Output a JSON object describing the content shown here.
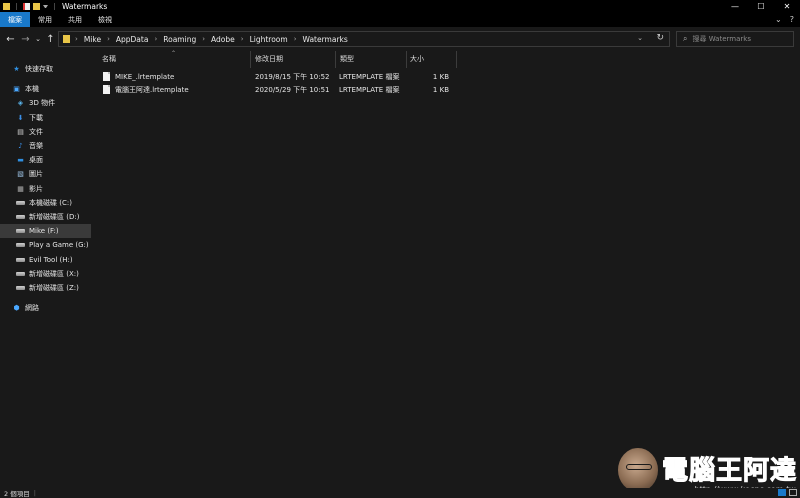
{
  "window": {
    "title": "Watermarks",
    "controls": {
      "minimize": "—",
      "maximize": "☐",
      "close": "✕"
    }
  },
  "ribbon": {
    "tabs": [
      {
        "label": "檔案",
        "active": true
      },
      {
        "label": "常用",
        "active": false
      },
      {
        "label": "共用",
        "active": false
      },
      {
        "label": "檢視",
        "active": false
      }
    ],
    "expand_icon": "⌄",
    "help_icon": "?"
  },
  "address": {
    "crumbs": [
      "Mike",
      "AppData",
      "Roaming",
      "Adobe",
      "Lightroom",
      "Watermarks"
    ],
    "search_placeholder": "搜尋 Watermarks"
  },
  "nav": {
    "items": [
      {
        "label": "快速存取",
        "icon": "star-icon",
        "indent": 12,
        "selected": false
      },
      {
        "label": "本機",
        "icon": "computer-icon",
        "indent": 12,
        "selected": false
      },
      {
        "label": "3D 物件",
        "icon": "cube-icon",
        "indent": 16,
        "selected": false
      },
      {
        "label": "下載",
        "icon": "download-icon",
        "indent": 16,
        "selected": false
      },
      {
        "label": "文件",
        "icon": "document-icon",
        "indent": 16,
        "selected": false
      },
      {
        "label": "音樂",
        "icon": "music-icon",
        "indent": 16,
        "selected": false
      },
      {
        "label": "桌面",
        "icon": "desktop-icon",
        "indent": 16,
        "selected": false
      },
      {
        "label": "圖片",
        "icon": "pictures-icon",
        "indent": 16,
        "selected": false
      },
      {
        "label": "影片",
        "icon": "video-icon",
        "indent": 16,
        "selected": false
      },
      {
        "label": "本機磁碟 (C:)",
        "icon": "drive-icon",
        "indent": 16,
        "selected": false
      },
      {
        "label": "新增磁碟區 (D:)",
        "icon": "drive-icon",
        "indent": 16,
        "selected": false
      },
      {
        "label": "Mike (F:)",
        "icon": "drive-icon",
        "indent": 16,
        "selected": true
      },
      {
        "label": "Play a Game (G:)",
        "icon": "drive-icon",
        "indent": 16,
        "selected": false
      },
      {
        "label": "Evil Tool (H:)",
        "icon": "drive-icon",
        "indent": 16,
        "selected": false
      },
      {
        "label": "新增磁碟區 (X:)",
        "icon": "drive-icon",
        "indent": 16,
        "selected": false
      },
      {
        "label": "新增磁碟區 (Z:)",
        "icon": "drive-icon",
        "indent": 16,
        "selected": false
      },
      {
        "label": "網路",
        "icon": "network-icon",
        "indent": 12,
        "selected": false
      }
    ]
  },
  "columns": {
    "name": "名稱",
    "modified": "修改日期",
    "type": "類型",
    "size": "大小"
  },
  "files": [
    {
      "name": "MIKE_.lrtemplate",
      "modified": "2019/8/15 下午 10:52",
      "type": "LRTEMPLATE 檔案",
      "size": "1 KB"
    },
    {
      "name": "電腦王阿達.lrtemplate",
      "modified": "2020/5/29 下午 10:51",
      "type": "LRTEMPLATE 檔案",
      "size": "1 KB"
    }
  ],
  "status": {
    "count": "2 個項目"
  },
  "watermark": {
    "text": "電腦王阿達",
    "url": "http://www.kocpc.com.tw"
  },
  "colors": {
    "accent": "#1979ca",
    "background": "#191919",
    "titlebar": "#000000"
  }
}
